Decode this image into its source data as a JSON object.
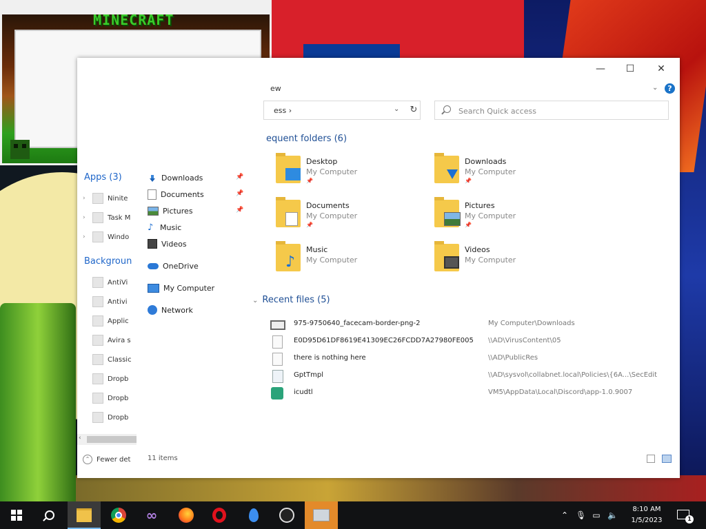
{
  "overlay": {
    "title": "MINECRAFT"
  },
  "window": {
    "ribbon_title": "ew",
    "minimize": "—",
    "maximize": "☐",
    "close": "✕",
    "help": "?"
  },
  "address": {
    "text": "ess  ›"
  },
  "search": {
    "placeholder": "Search Quick access"
  },
  "nav": {
    "items": [
      {
        "label": "Downloads",
        "icon": "downloads-icon",
        "pinned": true
      },
      {
        "label": "Documents",
        "icon": "documents-icon",
        "pinned": true
      },
      {
        "label": "Pictures",
        "icon": "pictures-icon",
        "pinned": true
      },
      {
        "label": "Music",
        "icon": "music-icon",
        "pinned": false
      },
      {
        "label": "Videos",
        "icon": "videos-icon",
        "pinned": false
      },
      {
        "label": "OneDrive",
        "icon": "onedrive-icon",
        "pinned": false
      },
      {
        "label": "My Computer",
        "icon": "computer-icon",
        "pinned": false
      },
      {
        "label": "Network",
        "icon": "network-icon",
        "pinned": false
      }
    ]
  },
  "left_pane": {
    "apps_header": "Apps (3)",
    "apps": [
      "Ninite",
      "Task M",
      "Windo"
    ],
    "background_header": "Backgroun",
    "background": [
      "AntiVi",
      "Antivi",
      "Applic",
      "Avira s",
      "Classic",
      "Dropb",
      "Dropb",
      "Dropb"
    ],
    "fewer": "Fewer det"
  },
  "frequent": {
    "header": "equent folders (6)",
    "folders": [
      {
        "name": "Desktop",
        "location": "My Computer"
      },
      {
        "name": "Downloads",
        "location": "My Computer"
      },
      {
        "name": "Documents",
        "location": "My Computer"
      },
      {
        "name": "Pictures",
        "location": "My Computer"
      },
      {
        "name": "Music",
        "location": "My Computer"
      },
      {
        "name": "Videos",
        "location": "My Computer"
      }
    ]
  },
  "recent": {
    "header": "Recent files (5)",
    "files": [
      {
        "name": "975-9750640_facecam-border-png-2",
        "path": "My Computer\\Downloads"
      },
      {
        "name": "E0D95D61DF8619E41309EC26FCDD7A27980FE005",
        "path": "\\\\AD\\VirusContent\\05"
      },
      {
        "name": "there is nothing here",
        "path": "\\\\AD\\PublicRes"
      },
      {
        "name": "GptTmpl",
        "path": "\\\\AD\\sysvol\\collabnet.local\\Policies\\{6A...\\SecEdit"
      },
      {
        "name": "icudtl",
        "path": "VM5\\AppData\\Local\\Discord\\app-1.0.9007"
      }
    ]
  },
  "status": {
    "items": "11 items"
  },
  "taskbar": {
    "time": "8:10 AM",
    "date": "1/5/2023",
    "notifications": "1"
  },
  "colors": {
    "accent": "#1f66c9",
    "taskbar": "#111214",
    "folder": "#f5c94a"
  }
}
